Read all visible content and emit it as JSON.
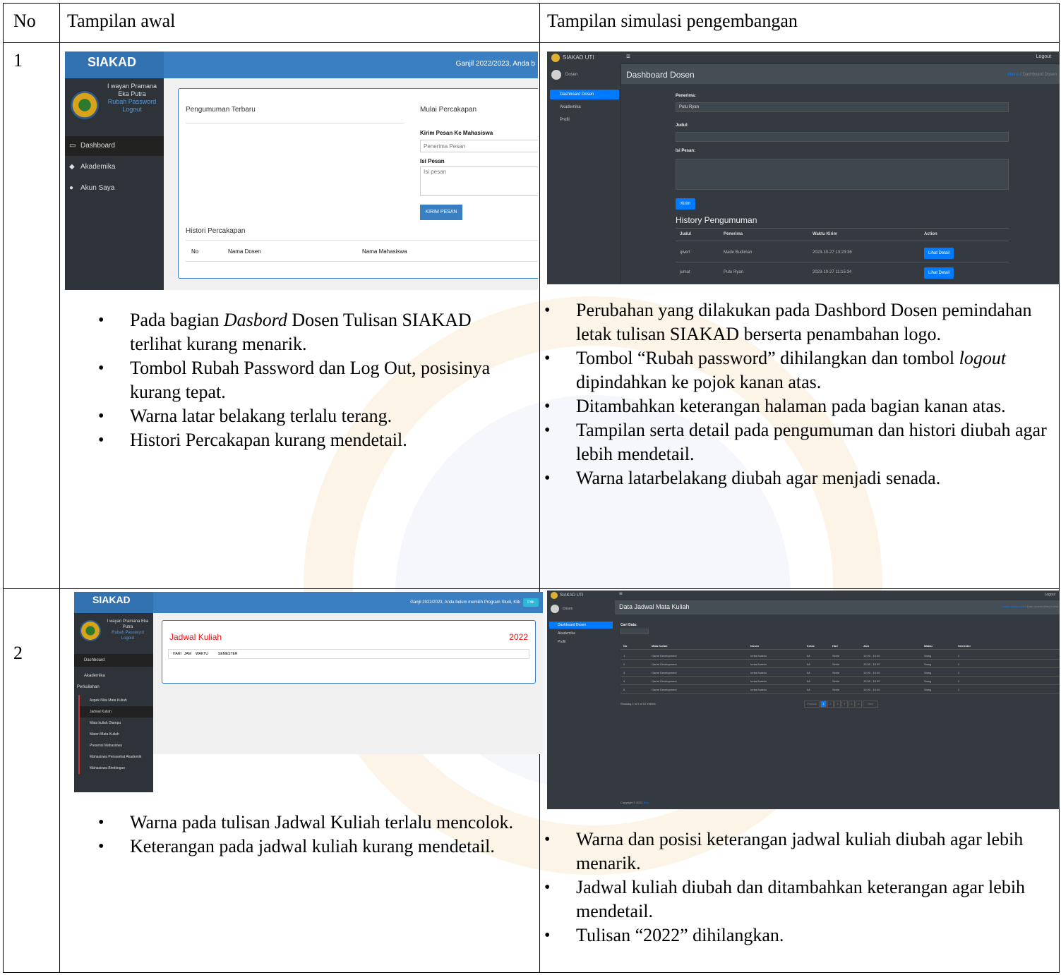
{
  "table": {
    "headers": {
      "no": "No",
      "initial": "Tampilan awal",
      "dev": "Tampilan simulasi pengembangan"
    },
    "rows": [
      {
        "no": "1",
        "initial_notes": [
          [
            "Pada bagian ",
            {
              "i": "Dasbord"
            },
            " Dosen Tulisan SIAKAD terlihat kurang menarik."
          ],
          [
            "Tombol Rubah Password dan Log Out, posisinya kurang tepat."
          ],
          [
            "Warna latar belakang terlalu terang."
          ],
          [
            "Histori Percakapan kurang mendetail."
          ]
        ],
        "dev_notes": [
          [
            "Perubahan yang dilakukan pada Dashbord Dosen pemindahan letak tulisan SIAKAD berserta penambahan logo."
          ],
          [
            "Tombol “Rubah password” dihilangkan dan tombol ",
            {
              "i": "logout"
            },
            " dipindahkan ke pojok kanan atas."
          ],
          [
            "Ditambahkan keterangan halaman pada bagian kanan atas."
          ],
          [
            "Tampilan serta detail pada pengumuman dan histori diubah agar lebih mendetail."
          ],
          [
            "Warna latarbelakang diubah agar menjadi senada."
          ]
        ]
      },
      {
        "no": "2",
        "initial_notes": [
          [
            "Warna pada tulisan Jadwal Kuliah terlalu mencolok."
          ],
          [
            "Keterangan pada jadwal kuliah kurang mendetail."
          ]
        ],
        "dev_notes": [
          [
            "Warna dan posisi keterangan jadwal kuliah diubah agar lebih menarik."
          ],
          [
            "Jadwal kuliah diubah dan ditambahkan keterangan agar lebih mendetail."
          ],
          [
            "Tulisan “2022” dihilangkan."
          ]
        ]
      }
    ]
  },
  "old1": {
    "brand": "SIAKAD",
    "semester": "Ganjil 2022/2023, Anda b",
    "user": "I wayan Pramana Eka Putra",
    "rubah": "Rubah Password",
    "logout": "Logout",
    "nav": [
      "Dashboard",
      "Akademika",
      "Akun Saya"
    ],
    "pengumuman": "Pengumuman Terbaru",
    "mulai": "Mulai Percakapan",
    "kirim_ke": "Kirim Pesan Ke Mahasiswa",
    "penerima_ph": "Penerima Pesan",
    "isi": "Isi Pesan",
    "isi_ph": "Isi pesan",
    "btn": "KIRIM PESAN",
    "histori": "Histori Percakapan",
    "cols": [
      "No",
      "Nama Dosen",
      "Nama Mahasiswa"
    ]
  },
  "new1": {
    "brand": "SIAKAD UTI",
    "logout": "Logout",
    "role": "Dosen",
    "nav": [
      "Dashboard Dosen",
      "Akademika",
      "Profil"
    ],
    "title": "Dashboard Dosen",
    "crumb_home": "Home",
    "crumb_cur": "Dashboard Dosen",
    "penerima_lbl": "Penerima:",
    "penerima_val": "Putu Ryan",
    "judul_lbl": "Judul:",
    "isi_lbl": "Isi Pesan:",
    "btn": "Kirim",
    "history_title": "History Pengumuman",
    "cols": [
      "Judul",
      "Penerima",
      "Waktu Kirim",
      "Action"
    ],
    "rows": [
      {
        "judul": "qwert",
        "penerima": "Made Budiman",
        "waktu": "2023-10-27 13:23:36",
        "action": "Lihat Detail"
      },
      {
        "judul": "jumat",
        "penerima": "Putu Ryan",
        "waktu": "2023-10-27 11:15:34",
        "action": "Lihat Detail"
      }
    ]
  },
  "old2": {
    "brand": "SIAKAD",
    "semester": "Ganjil 2022/2023, Anda belum memilih Program Studi, Klik",
    "pilih": "Pilih",
    "user": "I wayan Pramana Eka Putra",
    "rubah": "Rubah Password",
    "logout": "Logout",
    "nav": [
      "Dashboard",
      "Akademika"
    ],
    "sub_header": "Perkuliahan",
    "sub": [
      "Aspek Nilai Mata Kuliah",
      "Jadwal Kuliah",
      "Mata kuliah Diampu",
      "Materi Mata Kuliah",
      "Presensi Mahasiswa",
      "Mahasiswa Penasehat Akademik",
      "Mahasiswa Bimbingan"
    ],
    "title": "Jadwal Kuliah",
    "year": "2022",
    "cols": [
      "HARI",
      "JAM",
      "WAKTU",
      "SEMESTER"
    ]
  },
  "new2": {
    "brand": "SIAKAD UTI",
    "logout": "Logout",
    "role": "Dosen",
    "nav": [
      "Dashboard Dosen",
      "Akademika",
      "Profil"
    ],
    "title": "Data Jadwal Mata Kuliah",
    "crumb_home": "Home Dashboard",
    "crumb_cur": "Data Jadwal Mata Kuliah",
    "cari": "Cari Data:",
    "cols": [
      "No",
      "Mata Kuliah",
      "Dosen",
      "Kelas",
      "Hari",
      "Jam",
      "Waktu",
      "Semester"
    ],
    "rows": [
      [
        "1",
        "Game Development",
        "Indra Ananta",
        "6A",
        "Senin",
        "10.00 - 10.30",
        "Siang",
        "2"
      ],
      [
        "2",
        "Game Development",
        "Indra Ananta",
        "6A",
        "Senin",
        "10.00 - 10.30",
        "Siang",
        "2"
      ],
      [
        "3",
        "Game Development",
        "Indra Ananta",
        "6A",
        "Senin",
        "10.00 - 10.30",
        "Siang",
        "2"
      ],
      [
        "4",
        "Game Development",
        "Indra Ananta",
        "6A",
        "Senin",
        "10.00 - 10.30",
        "Siang",
        "2"
      ],
      [
        "5",
        "Game Development",
        "Indra Ananta",
        "6A",
        "Senin",
        "10.00 - 10.30",
        "Siang",
        "2"
      ]
    ],
    "showing": "Showing 1 to 5 of 57 entries",
    "pager": [
      "Previous",
      "1",
      "2",
      "3",
      "4",
      "5",
      "6",
      "Next"
    ],
    "footer_a": "Copyright © 2023",
    "footer_b": "Ikhs."
  }
}
